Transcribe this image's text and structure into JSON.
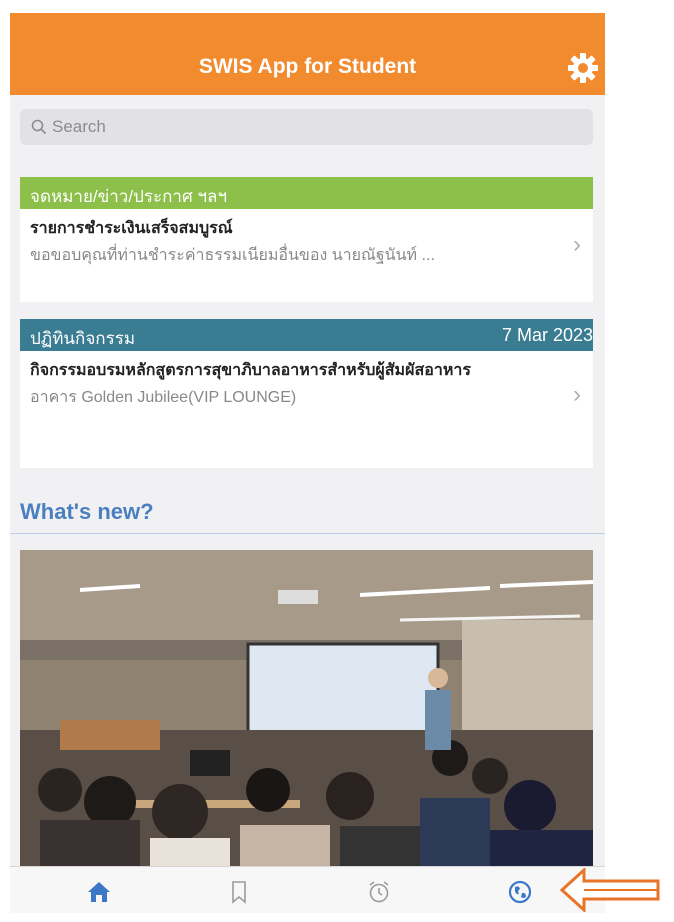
{
  "header": {
    "title": "SWIS App for Student"
  },
  "search": {
    "placeholder": "Search"
  },
  "notice": {
    "section_label": "จดหมาย/ข่าว/ประกาศ ฯลฯ",
    "title": "รายการชำระเงินเสร็จสมบูรณ์",
    "subtitle": "ขอขอบคุณที่ท่านชำระค่าธรรมเนียมอื่นของ นายณัฐนันท์ ..."
  },
  "activity": {
    "section_label": "ปฏิทินกิจกรรม",
    "date": "7 Mar 2023",
    "title": "กิจกรรมอบรมหลักสูตรการสุขาภิบาลอาหารสำหรับผู้สัมผัสอาหาร",
    "location": "อาคาร Golden Jubilee(VIP LOUNGE)"
  },
  "whats_new": {
    "heading": "What's new?"
  },
  "colors": {
    "header": "#f28a2e",
    "notice_header": "#8cc04a",
    "activity_header": "#3a7d92",
    "accent_blue": "#4a7fc0",
    "tab_active": "#3b78c8",
    "arrow": "#e8742a"
  },
  "tabs": [
    {
      "icon": "home-icon",
      "active": true
    },
    {
      "icon": "bookmark-icon",
      "active": false
    },
    {
      "icon": "alarm-clock-icon",
      "active": false
    },
    {
      "icon": "globe-icon",
      "active": false
    }
  ]
}
